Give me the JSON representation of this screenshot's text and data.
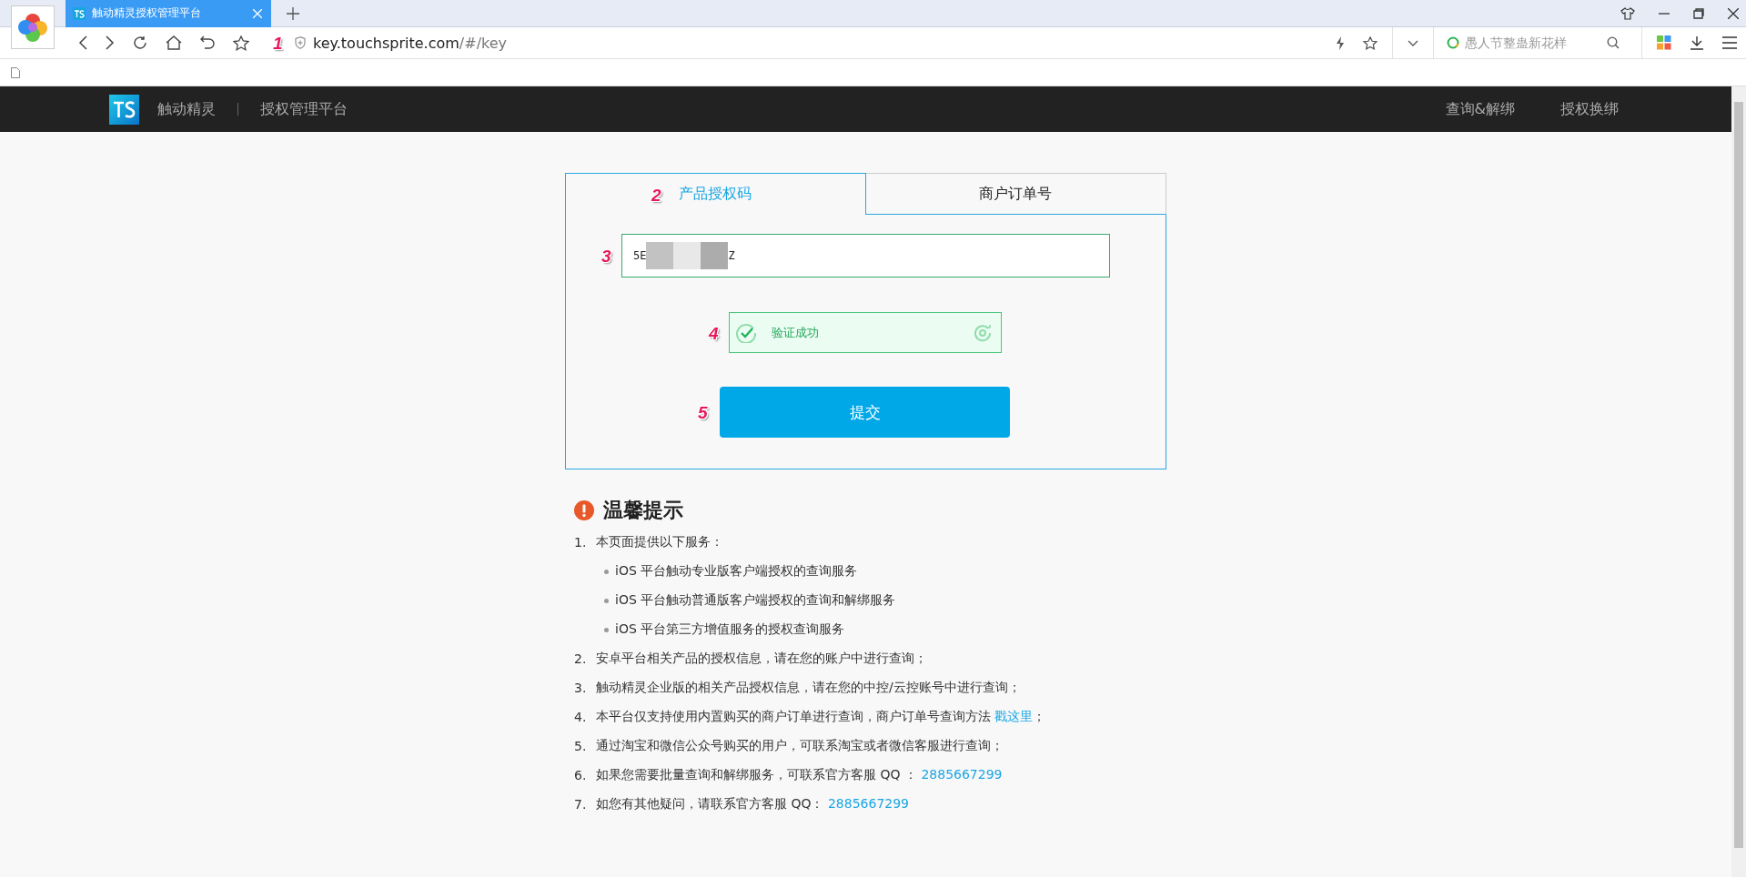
{
  "browser": {
    "tab": {
      "title": "触动精灵授权管理平台",
      "selected": true
    },
    "url": {
      "host": "key.touchsprite.com",
      "path": "/#/key",
      "callout": "1"
    },
    "search": {
      "placeholder": "愚人节整蛊新花样"
    }
  },
  "site": {
    "brand": "触动精灵",
    "subtitle": "授权管理平台",
    "nav": [
      "查询&解绑",
      "授权换绑"
    ]
  },
  "tabs": [
    {
      "label": "产品授权码",
      "selected": true,
      "callout": "2"
    },
    {
      "label": "商户订单号",
      "selected": false
    }
  ],
  "code_field": {
    "value_start": "5E",
    "value_end": "Z",
    "callout": "3"
  },
  "verify": {
    "text": "验证成功",
    "verified": true,
    "callout": "4"
  },
  "submit": {
    "label": "提交",
    "callout": "5"
  },
  "tips": {
    "title": "温馨提示",
    "items": [
      {
        "number": "1.",
        "text": "本页面提供以下服务：",
        "children": [
          "iOS 平台触动专业版客户端授权的查询服务",
          "iOS 平台触动普通版客户端授权的查询和解绑服务",
          "iOS 平台第三方增值服务的授权查询服务"
        ]
      },
      {
        "number": "2.",
        "text": "安卓平台相关产品的授权信息，请在您的账户中进行查询；"
      },
      {
        "number": "3.",
        "text": "触动精灵企业版的相关产品授权信息，请在您的中控/云控账号中进行查询；"
      },
      {
        "number": "4.",
        "text": "本平台仅支持使用内置购买的商户订单进行查询，商户订单号查询方法",
        "link": "戳这里",
        "after": "；"
      },
      {
        "number": "5.",
        "text": "通过淘宝和微信公众号购买的用户，可联系淘宝或者微信客服进行查询；"
      },
      {
        "number": "6.",
        "text": "如果您需要批量查询和解绑服务，可联系官方客服 QQ ：",
        "link": "2885667299"
      },
      {
        "number": "7.",
        "text": "如您有其他疑问，请联系官方客服 QQ：",
        "link": "2885667299"
      }
    ]
  }
}
